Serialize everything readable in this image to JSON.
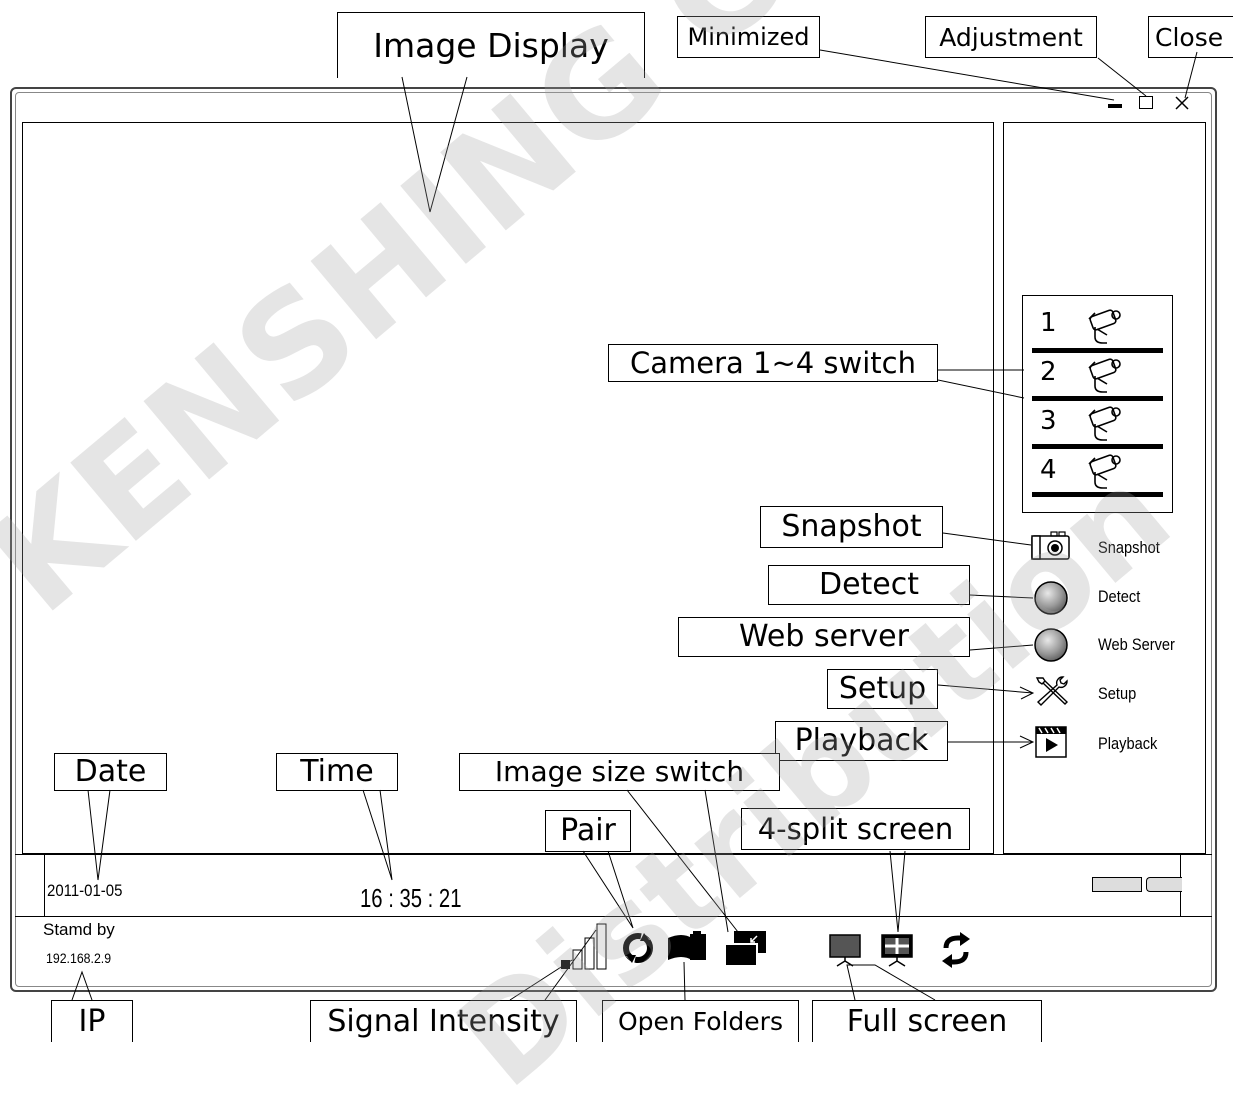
{
  "callouts": {
    "image_display": "Image Display",
    "minimized": "Minimized",
    "adjustment": "Adjustment",
    "close": "Close",
    "camera_switch": "Camera 1~4 switch",
    "snapshot": "Snapshot",
    "detect": "Detect",
    "web_server": "Web server",
    "setup": "Setup",
    "playback": "Playback",
    "date": "Date",
    "time": "Time",
    "image_size_switch": "Image size switch",
    "pair": "Pair",
    "four_split": "4-split screen",
    "ip": "IP",
    "signal_intensity": "Signal Intensity",
    "open_folders": "Open Folders",
    "full_screen": "Full screen"
  },
  "sidebar": {
    "cameras": [
      "1",
      "2",
      "3",
      "4"
    ],
    "snapshot_label": "Snapshot",
    "detect_label": "Detect",
    "web_server_label": "Web Server",
    "setup_label": "Setup",
    "playback_label": "Playback"
  },
  "status": {
    "date": "2011-01-05",
    "time": "16 : 35 : 21",
    "state": "Stamd by",
    "ip": "192.168.2.9"
  },
  "watermark": {
    "line1": "KENSHING Confidential",
    "line2": "Distribution"
  },
  "icons": {
    "title_bar": [
      "minimize-icon",
      "maximize-icon",
      "close-icon"
    ],
    "toolbar": [
      "signal-intensity-icon",
      "pair-icon",
      "open-folders-icon",
      "image-size-icon",
      "full-screen-icon",
      "four-split-icon",
      "refresh-icon"
    ]
  }
}
